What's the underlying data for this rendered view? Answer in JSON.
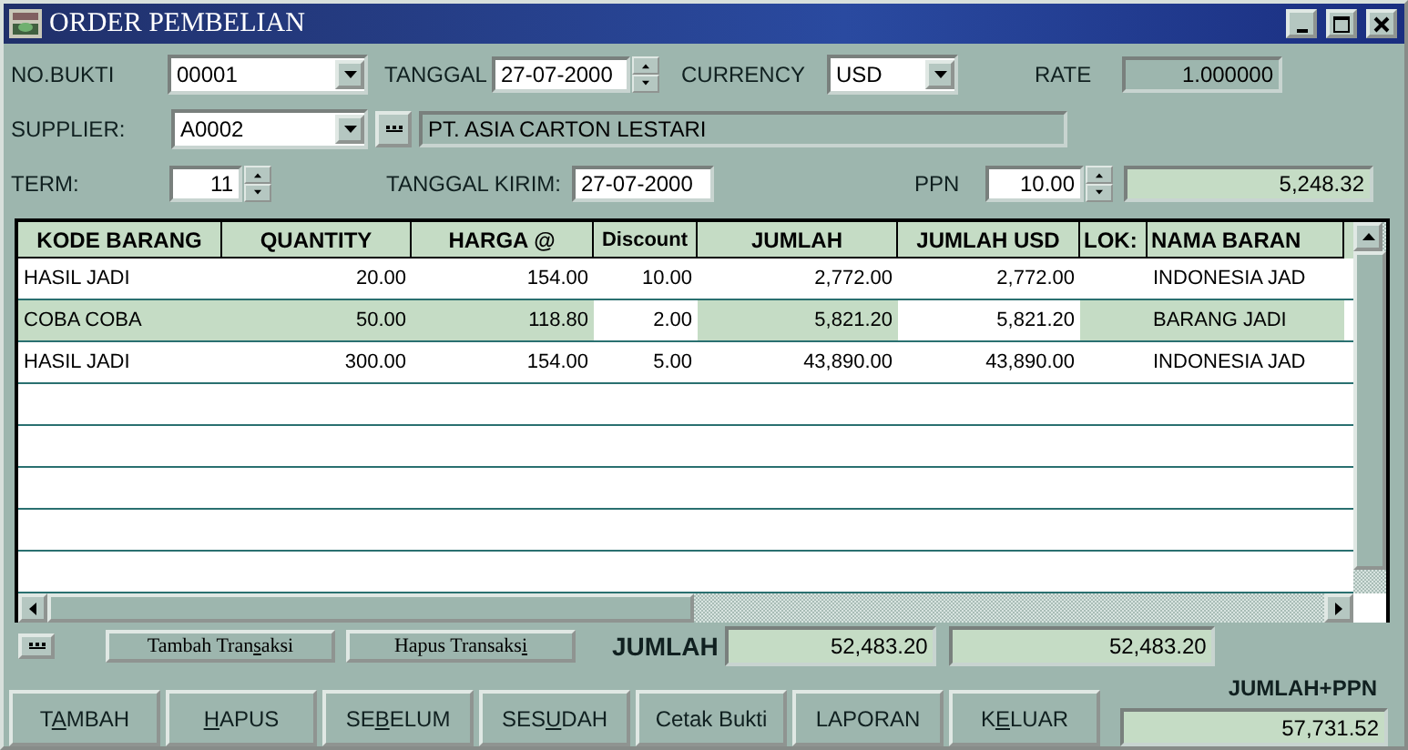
{
  "window": {
    "title": "ORDER PEMBELIAN"
  },
  "form": {
    "no_bukti": {
      "label": "NO.BUKTI",
      "value": "00001"
    },
    "tanggal": {
      "label": "TANGGAL",
      "value": "27-07-2000"
    },
    "currency": {
      "label": "CURRENCY",
      "value": "USD"
    },
    "rate": {
      "label": "RATE",
      "value": "1.000000"
    },
    "supplier": {
      "label": "SUPPLIER:",
      "value": "A0002",
      "name": "PT. ASIA CARTON LESTARI"
    },
    "term": {
      "label": "TERM:",
      "value": "11"
    },
    "tanggal_kirim": {
      "label": "TANGGAL KIRIM:",
      "value": "27-07-2000"
    },
    "ppn": {
      "label": "PPN",
      "value": "10.00",
      "amount": "5,248.32"
    }
  },
  "table": {
    "columns": [
      {
        "label": "KODE BARANG",
        "kind": "text",
        "highlight_on_select": true
      },
      {
        "label": "QUANTITY",
        "kind": "number",
        "highlight_on_select": true
      },
      {
        "label": "HARGA @",
        "kind": "number",
        "highlight_on_select": true
      },
      {
        "label": "Discount",
        "kind": "number",
        "highlight_on_select": false
      },
      {
        "label": "JUMLAH",
        "kind": "number",
        "highlight_on_select": true
      },
      {
        "label": "JUMLAH USD",
        "kind": "number",
        "highlight_on_select": false
      },
      {
        "label": "LOK:",
        "kind": "text",
        "highlight_on_select": true
      },
      {
        "label": "NAMA BARAN",
        "kind": "text",
        "highlight_on_select": true
      }
    ],
    "rows": [
      {
        "selected": false,
        "cells": [
          "HASIL JADI",
          "20.00",
          "154.00",
          "10.00",
          "2,772.00",
          "2,772.00",
          "",
          "INDONESIA JAD"
        ]
      },
      {
        "selected": true,
        "cells": [
          "COBA COBA",
          "50.00",
          "118.80",
          "2.00",
          "5,821.20",
          "5,821.20",
          "",
          "BARANG JADI"
        ]
      },
      {
        "selected": false,
        "cells": [
          "HASIL JADI",
          "300.00",
          "154.00",
          "5.00",
          "43,890.00",
          "43,890.00",
          "",
          "INDONESIA JAD"
        ]
      }
    ]
  },
  "detail_buttons": [
    {
      "before": "Tambah Tran",
      "key": "s",
      "after": "aksi"
    },
    {
      "before": "Hapus Transaks",
      "key": "i"
    }
  ],
  "totals": {
    "label": "JUMLAH",
    "jumlah": "52,483.20",
    "jumlah_usd": "52,483.20",
    "ppn_label": "JUMLAH+PPN",
    "jumlah_ppn": "57,731.52"
  },
  "buttons": [
    {
      "before": "T",
      "key": "A",
      "after": "MBAH"
    },
    {
      "key": "H",
      "after": "APUS"
    },
    {
      "before": "SE",
      "key": "B",
      "after": "ELUM"
    },
    {
      "before": "SES",
      "key": "U",
      "after": "DAH"
    },
    {
      "before": "Cetak Bukti"
    },
    {
      "before": "LAPORAN"
    },
    {
      "before": "K",
      "key": "E",
      "after": "LUAR"
    }
  ]
}
